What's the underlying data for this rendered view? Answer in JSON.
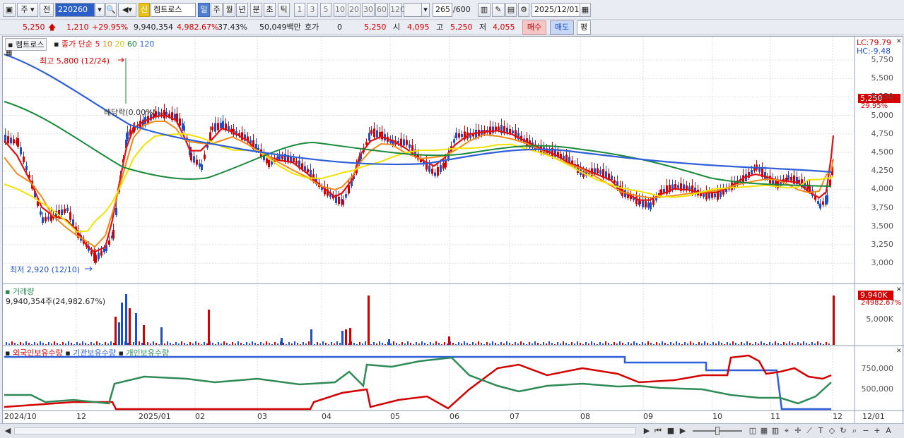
{
  "toolbar": {
    "period_type": "주",
    "prev_label": "전",
    "code": "220260",
    "new_badge": "신",
    "stock_name": "켐트로스",
    "periods": [
      "일",
      "주",
      "월",
      "년",
      "분",
      "초",
      "틱"
    ],
    "active_period": "일",
    "intervals": [
      "1",
      "3",
      "5",
      "10",
      "20",
      "30",
      "60",
      "120"
    ],
    "count_current": "265",
    "count_total": "/600",
    "date": "2025/12/01"
  },
  "quote": {
    "price": "5,250",
    "change": "1,210",
    "change_pct": "+29.95%",
    "volume": "9,940,354",
    "volume_ratio": "4,982.67%",
    "turnover_rate": "37.43%",
    "amount": "50,049백만",
    "hoga_label": "호가",
    "hoga_value": "0",
    "hoga_price": "5,250",
    "open_label": "시",
    "open": "4,095",
    "high_label": "고",
    "high": "5,250",
    "low_label": "저",
    "low": "4,055",
    "buy_label": "매수",
    "sell_label": "매도",
    "eval_label": "평"
  },
  "price_pane": {
    "stock_tag": "켐트로스",
    "ma_label": "종가 단순",
    "ma_periods": [
      "5",
      "10",
      "20",
      "60",
      "120"
    ],
    "ma_colors": [
      "#e01010",
      "#f08a18",
      "#f2e200",
      "#1a8a3a",
      "#2f5fd8"
    ],
    "lc": "LC:79.79",
    "hc": "HC:-9.48",
    "current_tag": "5,250",
    "current_pct": "29.95%",
    "high_note": "최고 5,800 (12/24)",
    "low_note": "최저 2,920 (12/10)",
    "dividend_note": "배당락(0.00%)",
    "y_ticks": [
      "5,750",
      "5,500",
      "5,250",
      "5,000",
      "4,750",
      "4,500",
      "4,250",
      "4,000",
      "3,750",
      "3,500",
      "3,250",
      "3,000"
    ]
  },
  "volume_pane": {
    "title": "거래량",
    "info": "9,940,354주(24,982.67%)",
    "current_tag": "9,940K",
    "current_pct": "24982.67%",
    "y_ticks": [
      "5,000K"
    ]
  },
  "holding_pane": {
    "series_labels": [
      "외국인보유수량",
      "기관보유수량",
      "개인보유수량"
    ],
    "series_colors": [
      "#d40000",
      "#2f5fd8",
      "#2e8b57"
    ],
    "y_ticks": [
      "750,000",
      "500,000"
    ]
  },
  "x_axis": {
    "labels": [
      "2024/10",
      "12",
      "2025/01",
      "02",
      "03",
      "04",
      "05",
      "06",
      "07",
      "08",
      "09",
      "10",
      "11",
      "12"
    ],
    "end_label": "12/01"
  },
  "colors": {
    "up": "#d40000",
    "down": "#1f4fc8",
    "accent": "#4f7fd1"
  }
}
